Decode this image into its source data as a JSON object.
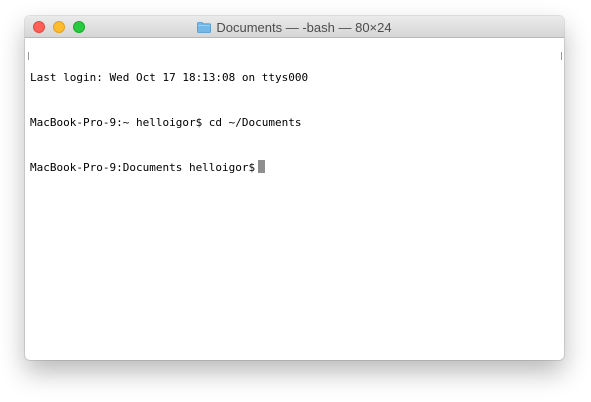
{
  "window": {
    "title": "Documents — -bash — 80×24",
    "folder_icon": "folder-icon"
  },
  "terminal": {
    "lines": [
      "Last login: Wed Oct 17 18:13:08 on ttys000",
      "MacBook-Pro-9:~ helloigor$ cd ~/Documents",
      "MacBook-Pro-9:Documents helloigor$"
    ]
  },
  "colors": {
    "close": "#fc5f57",
    "minimize": "#fdbc2e",
    "zoom": "#29c940",
    "cursor": "#8e8e8e",
    "folder": "#74b8e8"
  }
}
